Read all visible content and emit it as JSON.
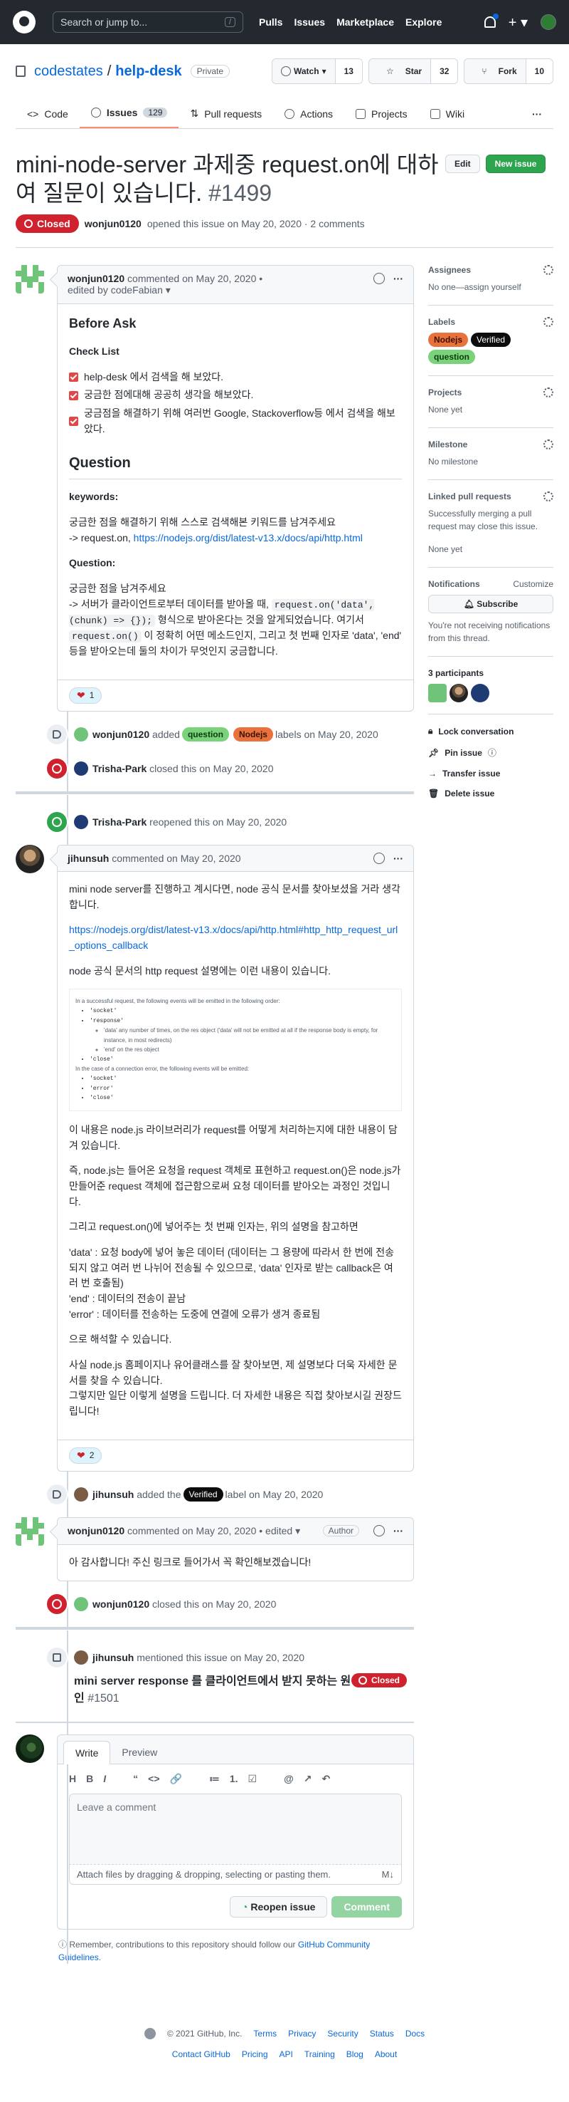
{
  "header": {
    "search_placeholder": "Search or jump to...",
    "search_key": "/",
    "nav": [
      "Pulls",
      "Issues",
      "Marketplace",
      "Explore"
    ]
  },
  "repo": {
    "owner": "codestates",
    "sep": "/",
    "name": "help-desk",
    "visibility": "Private",
    "watch_label": "Watch",
    "watch_count": "13",
    "star_label": "Star",
    "star_count": "32",
    "fork_label": "Fork",
    "fork_count": "10",
    "tabs": [
      {
        "label": "Code"
      },
      {
        "label": "Issues",
        "count": "129"
      },
      {
        "label": "Pull requests"
      },
      {
        "label": "Actions"
      },
      {
        "label": "Projects"
      },
      {
        "label": "Wiki"
      }
    ],
    "more": "···"
  },
  "issue": {
    "title": "mini-node-server 과제중 request.on에 대하여 질문이 있습니다.",
    "number": "#1499",
    "edit_label": "Edit",
    "new_issue_label": "New issue",
    "state": "Closed",
    "author": "wonjun0120",
    "opened_text": "opened this issue on May 20, 2020 · 2 comments"
  },
  "comments": {
    "first": {
      "author": "wonjun0120",
      "meta": "commented on May 20, 2020 •",
      "edited": "edited by codeFabian",
      "before_ask": "Before Ask",
      "check_list_title": "Check List",
      "checks": [
        "help-desk 에서 검색을 해 보았다.",
        "궁금한 점에대해 공공히 생각을 해보았다.",
        "궁금점을 해결하기 위해 여러번 Google, Stackoverflow등 에서 검색을 해보았다."
      ],
      "question_heading": "Question",
      "keywords_label": "keywords:",
      "keywords_text": "궁금한 점을 해결하기 위해 스스로 검색해본 키워드를 남겨주세요",
      "keywords_arrow": "-> request.on,",
      "keywords_link": "https://nodejs.org/dist/latest-v13.x/docs/api/http.html",
      "question_label": "Question:",
      "q_line1": "궁금한 점을 남겨주세요",
      "q_pre": "-> 서버가 클라이언트로부터 데이터를 받아올 때,",
      "q_code1": "request.on('data', (chunk) => {});",
      "q_mid": "형식으로 받아온다는 것을 알게되었습니다. 여기서",
      "q_code2": "request.on()",
      "q_post": "이 정확히 어떤 메소드인지, 그리고 첫 번째 인자로 'data', 'end' 등을 받아오는데 둘의 차이가 무엇인지 궁금합니다.",
      "reaction_count": "1"
    },
    "second": {
      "author": "jihunsuh",
      "meta": "commented on May 20, 2020",
      "p1": "mini node server를 진행하고 계시다면, node 공식 문서를 찾아보셨을 거라 생각합니다.",
      "link": "https://nodejs.org/dist/latest-v13.x/docs/api/http.html#http_http_request_url_options_callback",
      "p2": "node 공식 문서의 http request 설명에는 이런 내용이 있습니다.",
      "img_line1": "In a successful request, the following events will be emitted in the following order:",
      "img_items": [
        "'socket'",
        "'response'"
      ],
      "img_sub1": "'data' any number of times, on the res object ('data' will not be emitted at all if the response body is empty, for instance, in most redirects)",
      "img_sub2": "'end' on the res object",
      "img_close": "'close'",
      "img_line2": "In the case of a connection error, the following events will be emitted:",
      "img_items2": [
        "'socket'",
        "'error'",
        "'close'"
      ],
      "p3": "이 내용은 node.js 라이브러리가 request를 어떻게 처리하는지에 대한 내용이 담겨 있습니다.",
      "p4": "즉, node.js는 들어온 요청을 request 객체로 표현하고 request.on()은 node.js가 만들어준 request 객체에 접근함으로써 요청 데이터를 받아오는 과정인 것입니다.",
      "p5": "그리고 request.on()에 넣어주는 첫 번째 인자는, 위의 설명을 참고하면",
      "p6a": "'data' : 요청 body에 넣어 놓은 데이터 (데이터는 그 용량에 따라서 한 번에 전송되지 않고 여러 번 나뉘어 전송될 수 있으므로, 'data' 인자로 받는 callback은 여러 번 호출됨)",
      "p6b": "'end' : 데이터의 전송이 끝남",
      "p6c": "'error' : 데이터를 전송하는 도중에 연결에 오류가 생겨 종료됨",
      "p7": "으로 해석할 수 있습니다.",
      "p8a": "사실 node.js 홈페이지나 유어클래스를 잘 찾아보면, 제 설명보다 더욱 자세한 문서를 찾을 수 있습니다.",
      "p8b": "그렇지만 일단 이렇게 설명을 드립니다. 더 자세한 내용은 직접 찾아보시길 권장드립니다!",
      "reaction_count": "2"
    },
    "third": {
      "author": "wonjun0120",
      "meta": "commented on May 20, 2020 • edited ▾",
      "badge": "Author",
      "body": "아 감사합니다! 주신 링크로 들어가서 꼭 확인해보겠습니다!"
    }
  },
  "events": {
    "labeled": {
      "actor": "wonjun0120",
      "pre": "added",
      "labels": [
        "question",
        "Nodejs"
      ],
      "post": "labels on May 20, 2020"
    },
    "closed1": {
      "actor": "Trisha-Park",
      "text": "closed this on May 20, 2020"
    },
    "reopened": {
      "actor": "Trisha-Park",
      "text": "reopened this on May 20, 2020"
    },
    "verified": {
      "actor": "jihunsuh",
      "pre": "added the",
      "label": "Verified",
      "post": "label on May 20, 2020"
    },
    "closed2": {
      "actor": "wonjun0120",
      "text": "closed this on May 20, 2020"
    },
    "mention": {
      "actor": "jihunsuh",
      "text": "mentioned this issue on May 20, 2020",
      "title": "mini server response 를 클라이언트에서 받지 못하는 원인",
      "number": "#1501",
      "state": "Closed"
    }
  },
  "editor": {
    "write": "Write",
    "preview": "Preview",
    "tools": [
      "H",
      "B",
      "I",
      "“",
      "<>",
      "🔗",
      "≔",
      "1.",
      "☑",
      "@",
      "↗",
      "↶"
    ],
    "placeholder": "Leave a comment",
    "attach": "Attach files by dragging & dropping, selecting or pasting them.",
    "md": "M↓",
    "reopen": "Reopen issue",
    "comment": "Comment",
    "note_pre": "Remember, contributions to this repository should follow our",
    "note_link": "GitHub Community Guidelines",
    "note_post": "."
  },
  "sidebar": {
    "assignees": "Assignees",
    "assignees_val": "No one—assign yourself",
    "labels": "Labels",
    "label_list": [
      "Nodejs",
      "Verified",
      "question"
    ],
    "projects": "Projects",
    "projects_val": "None yet",
    "milestone": "Milestone",
    "milestone_val": "No milestone",
    "linked": "Linked pull requests",
    "linked_desc": "Successfully merging a pull request may close this issue.",
    "linked_val": "None yet",
    "notifications": "Notifications",
    "customize": "Customize",
    "subscribe": "Subscribe",
    "notif_desc": "You're not receiving notifications from this thread.",
    "participants": "3 participants",
    "lock": "Lock conversation",
    "pin": "Pin issue",
    "transfer": "Transfer issue",
    "delete": "Delete issue"
  },
  "footer": {
    "copyright": "© 2021 GitHub, Inc.",
    "row1": [
      "Terms",
      "Privacy",
      "Security",
      "Status",
      "Docs"
    ],
    "row2": [
      "Contact GitHub",
      "Pricing",
      "API",
      "Training",
      "Blog",
      "About"
    ]
  },
  "colors": {
    "accent": "#0969da",
    "closed": "#cf222e",
    "open": "#2da44e"
  }
}
